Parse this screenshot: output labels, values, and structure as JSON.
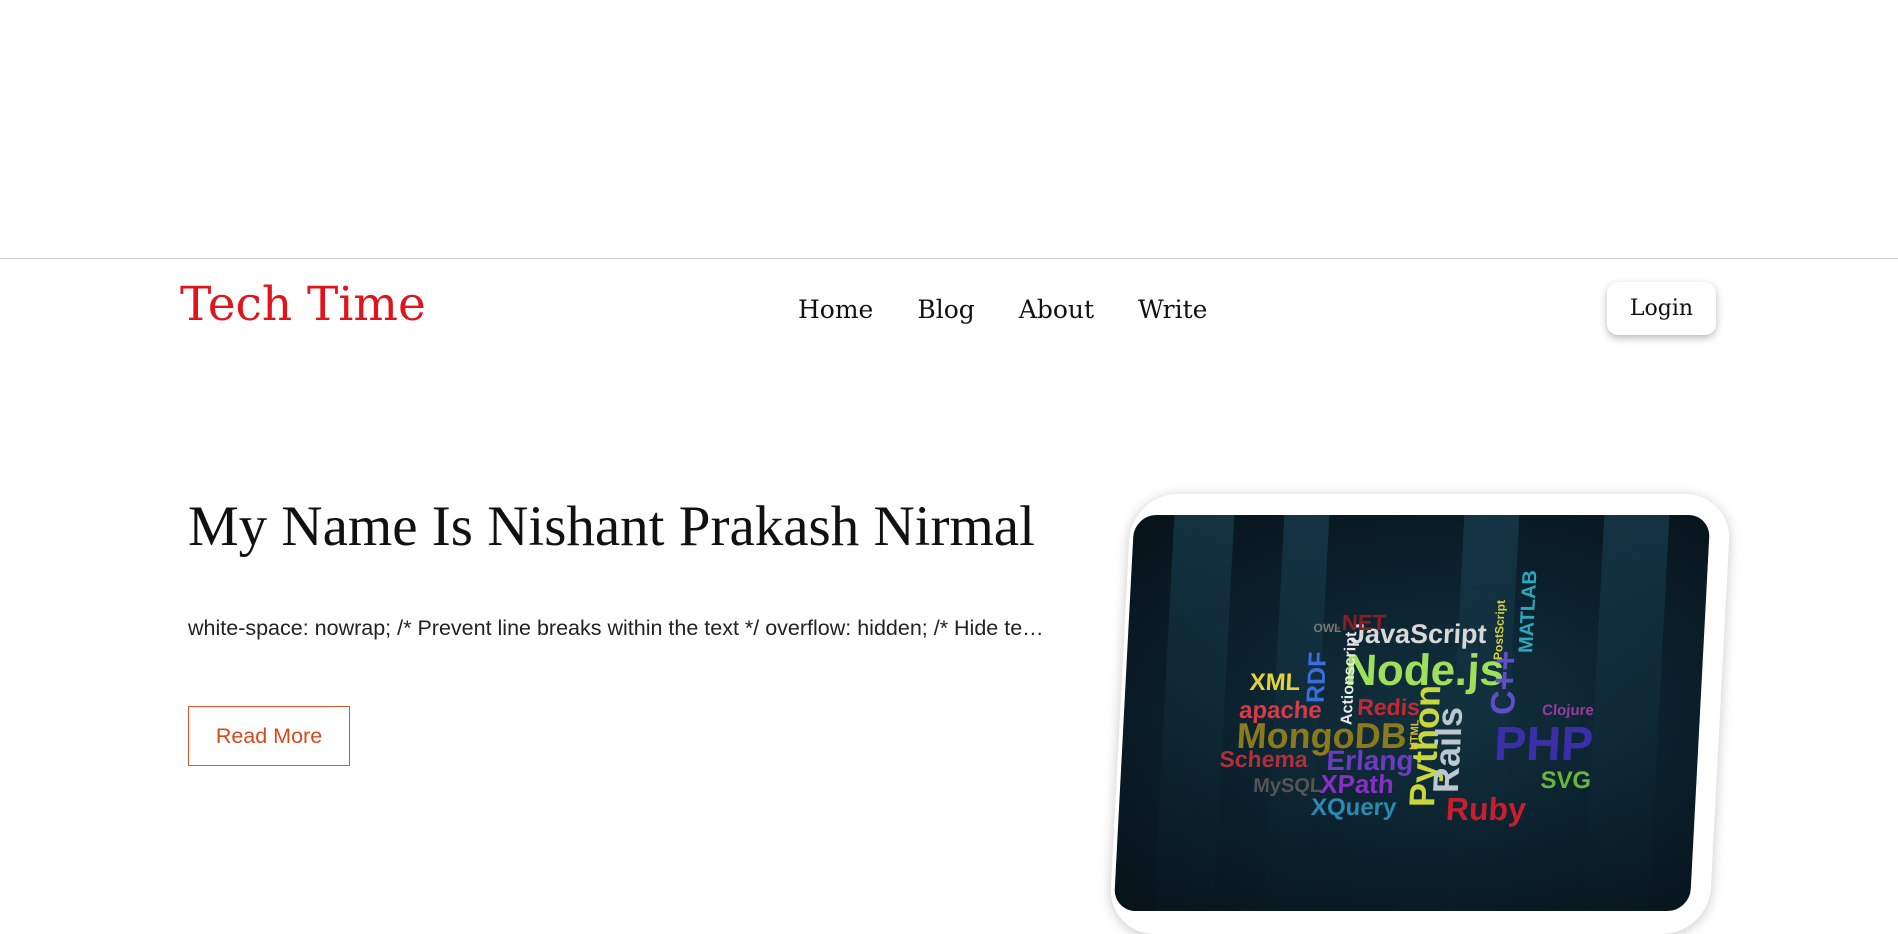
{
  "header": {
    "logo": "Tech Time",
    "nav": [
      "Home",
      "Blog",
      "About",
      "Write"
    ],
    "login_label": "Login"
  },
  "hero": {
    "title": "My Name Is Nishant Prakash Nirmal",
    "description": "white-space: nowrap; /* Prevent line breaks within the text */ overflow: hidden; /* Hide text that overflows the container */",
    "read_more_label": "Read More"
  },
  "image": {
    "words": [
      {
        "text": "JavaScript",
        "color": "#d8d8d8"
      },
      {
        "text": "Node.js",
        "color": "#9fe05a"
      },
      {
        "text": "XML",
        "color": "#e6d336"
      },
      {
        "text": "RDF",
        "color": "#3b6de0"
      },
      {
        "text": "Actionscript",
        "color": "#e8e8e8"
      },
      {
        "text": "apache",
        "color": "#d83a4a"
      },
      {
        "text": "Redis",
        "color": "#c02a34"
      },
      {
        "text": "MongoDB",
        "color": "#8a7a1c"
      },
      {
        "text": "Schema",
        "color": "#b0303a"
      },
      {
        "text": "Erlang",
        "color": "#6a3cc0"
      },
      {
        "text": "XPath",
        "color": "#8a2ec8"
      },
      {
        "text": "XQuery",
        "color": "#2a8ab0"
      },
      {
        "text": "Python",
        "color": "#c8d83a"
      },
      {
        "text": "Rails",
        "color": "#bcc7d0"
      },
      {
        "text": "PHP",
        "color": "#3a2fa8"
      },
      {
        "text": "SVG",
        "color": "#66b83c"
      },
      {
        "text": "Ruby",
        "color": "#c81e2e"
      },
      {
        "text": "C++",
        "color": "#5e4ec8"
      },
      {
        "text": "MATLAB",
        "color": "#2aa8c0"
      },
      {
        "text": "PostScript",
        "color": "#d8d03a"
      },
      {
        "text": "Clojure",
        "color": "#9a3aa0"
      },
      {
        "text": ".NET",
        "color": "#8a1e22"
      },
      {
        "text": "OWL",
        "color": "#777777"
      },
      {
        "text": "HTML",
        "color": "#e0c030"
      },
      {
        "text": "MySQL",
        "color": "#555555"
      }
    ]
  }
}
